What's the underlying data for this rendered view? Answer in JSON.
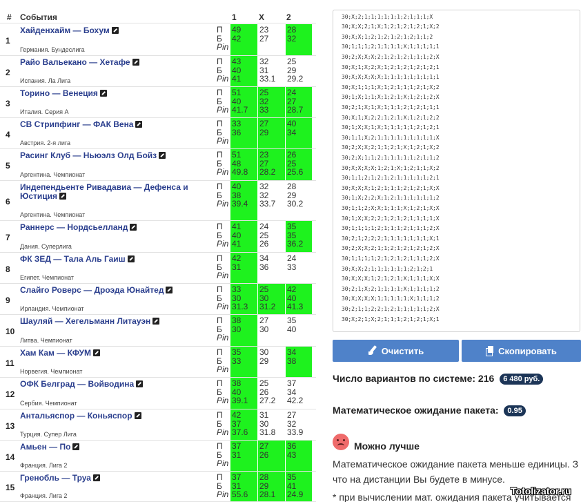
{
  "table": {
    "headers": {
      "num": "#",
      "events": "События",
      "c1": "1",
      "cx": "X",
      "c2": "2"
    },
    "row_labels": {
      "p": "П",
      "b": "Б",
      "pin": "Pin"
    },
    "matches": [
      {
        "n": "1",
        "title": "Хайденхайм — Бохум",
        "league": "Германия. Бундеслига",
        "p": [
          "49",
          "23",
          "28"
        ],
        "b": [
          "42",
          "27",
          "32"
        ],
        "pin": [
          "",
          "",
          ""
        ],
        "green": [
          1,
          0,
          1
        ]
      },
      {
        "n": "2",
        "title": "Райо Вальекано — Хетафе",
        "league": "Испания. Ла Лига",
        "p": [
          "43",
          "32",
          "25"
        ],
        "b": [
          "40",
          "31",
          "29"
        ],
        "pin": [
          "41",
          "33.1",
          "29.2"
        ],
        "green": [
          1,
          0,
          0
        ]
      },
      {
        "n": "3",
        "title": "Торино — Венеция",
        "league": "Италия. Серия А",
        "p": [
          "51",
          "25",
          "24"
        ],
        "b": [
          "40",
          "32",
          "27"
        ],
        "pin": [
          "41.7",
          "33",
          "28.7"
        ],
        "green": [
          1,
          1,
          1
        ]
      },
      {
        "n": "4",
        "title": "СВ Стрипфинг — ФАК Вена",
        "league": "Австрия. 2-я лига",
        "p": [
          "33",
          "27",
          "40"
        ],
        "b": [
          "36",
          "29",
          "34"
        ],
        "pin": [
          "",
          "",
          ""
        ],
        "green": [
          1,
          1,
          1
        ]
      },
      {
        "n": "5",
        "title": "Расинг Клуб — Ньюэлз Олд Бойз",
        "league": "Аргентина. Чемпионат",
        "p": [
          "51",
          "23",
          "26"
        ],
        "b": [
          "48",
          "27",
          "25"
        ],
        "pin": [
          "49.8",
          "28.2",
          "25.6"
        ],
        "green": [
          1,
          1,
          1
        ]
      },
      {
        "n": "6",
        "title": "Индепендьенте Ривадавиа — Дефенса и Юстиция",
        "league": "Аргентина. Чемпионат",
        "p": [
          "40",
          "32",
          "28"
        ],
        "b": [
          "38",
          "32",
          "29"
        ],
        "pin": [
          "39.4",
          "33.7",
          "30.2"
        ],
        "green": [
          1,
          0,
          0
        ]
      },
      {
        "n": "7",
        "title": "Раннерс — Нордсьелланд",
        "league": "Дания. Суперлига",
        "p": [
          "41",
          "24",
          "35"
        ],
        "b": [
          "40",
          "25",
          "35"
        ],
        "pin": [
          "41",
          "26",
          "36.2"
        ],
        "green": [
          1,
          0,
          1
        ]
      },
      {
        "n": "8",
        "title": "ФК ЗЕД — Тала Аль Гаиш",
        "league": "Египет. Чемпионат",
        "p": [
          "42",
          "34",
          "24"
        ],
        "b": [
          "31",
          "36",
          "33"
        ],
        "pin": [
          "",
          "",
          ""
        ],
        "green": [
          1,
          0,
          0
        ]
      },
      {
        "n": "9",
        "title": "Слайго Роверс — Дроэда Юнайтед",
        "league": "Ирландия. Чемпионат",
        "p": [
          "33",
          "25",
          "42"
        ],
        "b": [
          "30",
          "30",
          "40"
        ],
        "pin": [
          "31.3",
          "31.2",
          "41.3"
        ],
        "green": [
          1,
          1,
          1
        ]
      },
      {
        "n": "10",
        "title": "Шауляй — Хегельманн Литауэн",
        "league": "Литва. Чемпионат",
        "p": [
          "38",
          "27",
          "35"
        ],
        "b": [
          "30",
          "30",
          "40"
        ],
        "pin": [
          "",
          "",
          ""
        ],
        "green": [
          1,
          0,
          0
        ]
      },
      {
        "n": "11",
        "title": "Хам Кам — КФУМ",
        "league": "Норвегия. Чемпионат",
        "p": [
          "35",
          "30",
          "34"
        ],
        "b": [
          "33",
          "29",
          "38"
        ],
        "pin": [
          "",
          "",
          ""
        ],
        "green": [
          1,
          0,
          1
        ]
      },
      {
        "n": "12",
        "title": "ОФК Белград — Войводина",
        "league": "Сербия. Чемпионат",
        "p": [
          "38",
          "25",
          "37"
        ],
        "b": [
          "40",
          "26",
          "34"
        ],
        "pin": [
          "39.1",
          "27.2",
          "42.2"
        ],
        "green": [
          1,
          0,
          0
        ]
      },
      {
        "n": "13",
        "title": "Антальяспор — Коньяспор",
        "league": "Турция. Супер Лига",
        "p": [
          "42",
          "31",
          "27"
        ],
        "b": [
          "37",
          "30",
          "32"
        ],
        "pin": [
          "37.6",
          "31.8",
          "33.9"
        ],
        "green": [
          1,
          0,
          0
        ]
      },
      {
        "n": "14",
        "title": "Амьен — По",
        "league": "Франция. Лига 2",
        "p": [
          "37",
          "27",
          "36"
        ],
        "b": [
          "31",
          "26",
          "43"
        ],
        "pin": [
          "",
          "",
          ""
        ],
        "green": [
          1,
          1,
          1
        ]
      },
      {
        "n": "15",
        "title": "Гренобль — Труа",
        "league": "Франция. Лига 2",
        "p": [
          "37",
          "28",
          "35"
        ],
        "b": [
          "31",
          "29",
          "41"
        ],
        "pin": [
          "55.6",
          "28.1",
          "24.9"
        ],
        "green": [
          1,
          1,
          1
        ]
      }
    ]
  },
  "variants_text": [
    "30;2;1;X;1;2;1;X;1;2;1;1;1;X",
    "30;X;2;1;1;1;1;1;1;2;1;1;1;X",
    "30;X;X;2;1;X;1;2;1;2;1;2;1;X;2",
    "30;X;X;1;2;1;2;1;2;1;2;1;1;2",
    "30;1;1;1;2;1;1;1;1;X;1;1;1;1;1",
    "30;2;X;X;X;2;1;2;1;2;1;1;1;2;X",
    "30;X;1;X;2;X;1;2;1;2;1;2;1;2;1",
    "30;X;X;X;X;X;1;1;1;1;1;1;1;1;1",
    "30;X;1;1;1;X;1;2;1;1;1;2;1;X;2",
    "30;1;X;1;1;X;1;2;1;X;1;2;1;2;X",
    "30;2;1;X;1;X;1;1;1;2;1;2;1;1;1",
    "30;X;1;X;2;2;1;2;1;X;1;2;1;2;2",
    "30;1;X;X;1;X;1;1;1;1;1;2;1;2;1",
    "30;1;1;X;2;1;1;1;1;1;1;1;1;1;X",
    "30;2;X;X;2;1;1;2;1;X;1;2;1;X;2",
    "30;2;X;1;1;2;1;1;1;1;1;2;1;1;2",
    "30;X;X;X;X;1;2;1;X;1;2;1;1;X;2",
    "30;1;1;2;1;2;1;2;1;1;1;1;1;2;1",
    "30;X;X;X;1;2;1;1;1;2;1;2;1;X;X",
    "30;1;X;2;2;X;1;2;1;1;1;1;1;1;2",
    "30;1;1;2;X;X;1;1;1;X;1;2;1;X;X",
    "30;1;X;X;2;2;1;2;1;2;1;1;1;1;X",
    "30;1;1;1;1;2;1;1;1;2;1;1;1;2;X",
    "30;2;1;2;2;2;1;1;1;1;1;1;1;X;1",
    "30;2;X;X;2;1;1;2;1;2;1;2;1;2;X",
    "30;1;1;1;1;2;1;2;1;2;1;1;1;2;X",
    "30;X;X;2;1;1;1;1;1;1;2;1;2;1",
    "30;X;X;X;1;2;1;2;1;X;1;1;1;X;X",
    "30;2;1;X;2;1;1;1;1;X;1;1;1;1;2",
    "30;X;X;X;X;1;1;1;1;1;X;1;1;1;2",
    "30;2;1;1;2;2;1;2;1;1;1;1;1;2;X",
    "30;X;2;1;X;2;1;1;1;2;1;2;1;X;1"
  ],
  "buttons": {
    "clear": "Очистить",
    "copy": "Скопировать"
  },
  "stats": {
    "variants_label": "Число вариантов по системе: 216",
    "variants_price": "6 480 руб.",
    "expectation_label": "Математическое ожидание пакета:",
    "expectation_value": "0.95"
  },
  "message": {
    "title": "Можно лучше",
    "line1": "Математическое ожидание пакета меньше единицы. З",
    "line2": "что на дистанции Вы будете в минусе.",
    "line3": "* при вычислении мат. ожидания пакета учитывается"
  },
  "watermark": "Totolizator.ru",
  "colors": {
    "green": "#1ef21e",
    "link": "#2b3f8e",
    "button": "#4f82c9",
    "badge": "#1c3557"
  }
}
